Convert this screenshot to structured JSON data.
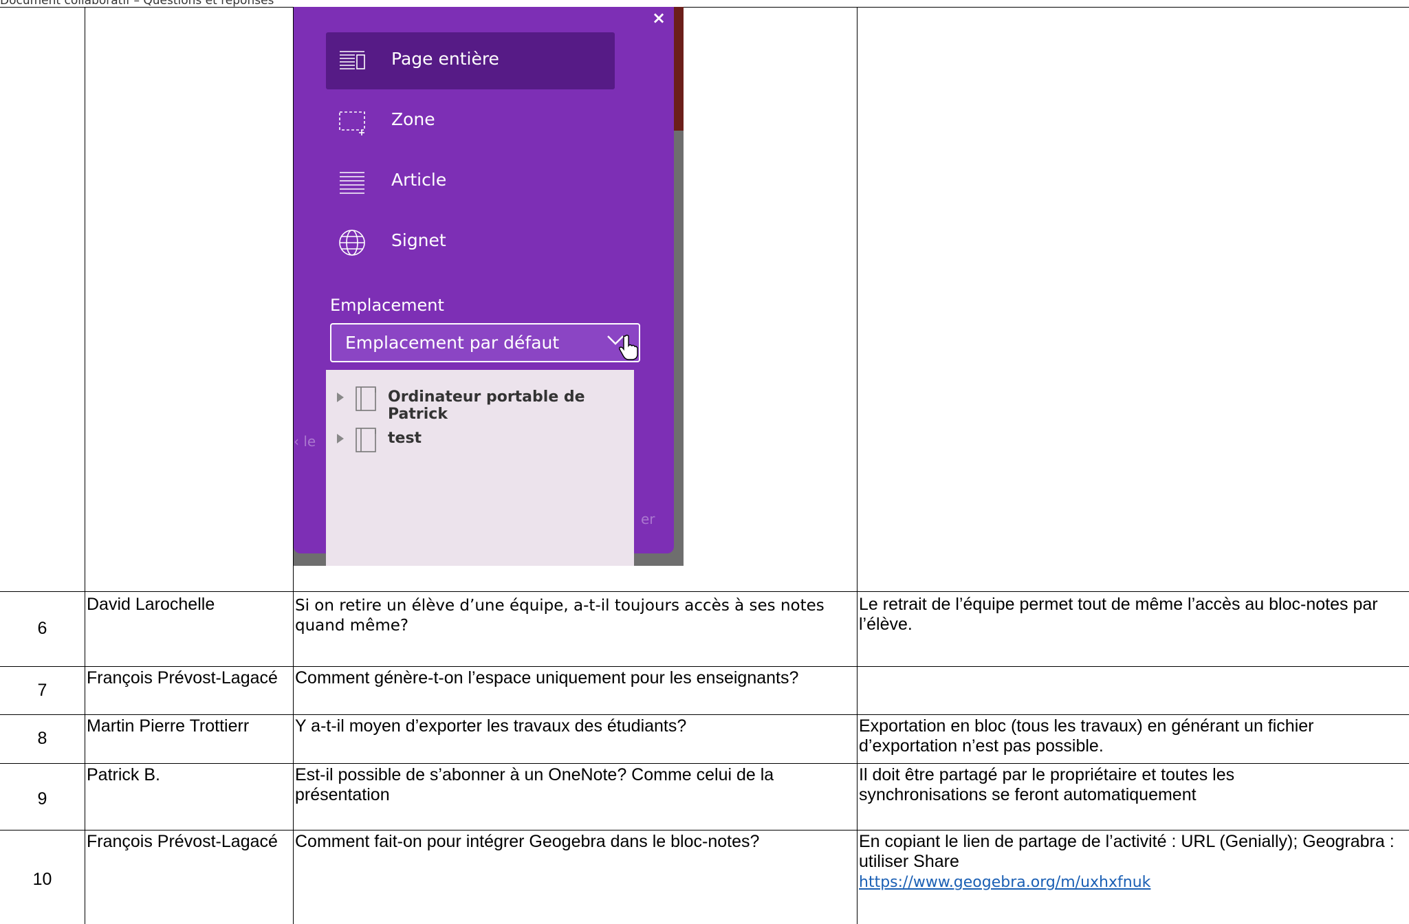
{
  "page_header": "Document collaboratif – Questions et réponses",
  "clipper": {
    "close_label": "×",
    "modes": [
      {
        "label": "Page entière",
        "icon": "full-page-icon",
        "selected": true
      },
      {
        "label": "Zone",
        "icon": "region-icon",
        "selected": false
      },
      {
        "label": "Article",
        "icon": "article-icon",
        "selected": false
      },
      {
        "label": "Signet",
        "icon": "globe-icon",
        "selected": false
      }
    ],
    "location_title": "Emplacement",
    "location_value": "Emplacement par défaut",
    "notebooks": [
      {
        "label": "Ordinateur portable de Patrick",
        "icon": "notebook-icon"
      },
      {
        "label": "test",
        "icon": "notebook-icon"
      }
    ],
    "colors": {
      "panel": "#7d2fb5",
      "selected": "#561b86",
      "dropdown": "#ece3ec"
    }
  },
  "rows": [
    {
      "num": "6",
      "name": "David Larochelle",
      "question": "Si on retire un élève d’une équipe, a-t-il toujours accès à ses notes quand même?",
      "answer": "Le retrait de l’équipe permet tout de même l’accès au bloc-notes par l’élève."
    },
    {
      "num": "7",
      "name": "François Prévost-Lagacé",
      "question": "Comment génère-t-on l’espace uniquement pour les enseignants?",
      "answer": ""
    },
    {
      "num": "8",
      "name": "Martin Pierre Trottierr",
      "question": "Y a-t-il moyen d’exporter les travaux des étudiants?",
      "answer": "Exportation en bloc (tous les travaux) en générant un fichier d’exportation n’est pas possible."
    },
    {
      "num": "9",
      "name": "Patrick B.",
      "question": "Est-il possible de s’abonner à un OneNote? Comme celui de la présentation",
      "answer": "Il doit être partagé par le propriétaire et toutes les synchronisations se feront automatiquement"
    },
    {
      "num": "10",
      "name": "François Prévost-Lagacé",
      "question": "Comment fait-on pour intégrer Geogebra dans le bloc-notes?",
      "answer": "En copiant le lien de partage de l’activité : URL (Genially); Geograbra : utiliser Share",
      "link": "https://www.geogebra.org/m/uxhxfnuk"
    }
  ]
}
